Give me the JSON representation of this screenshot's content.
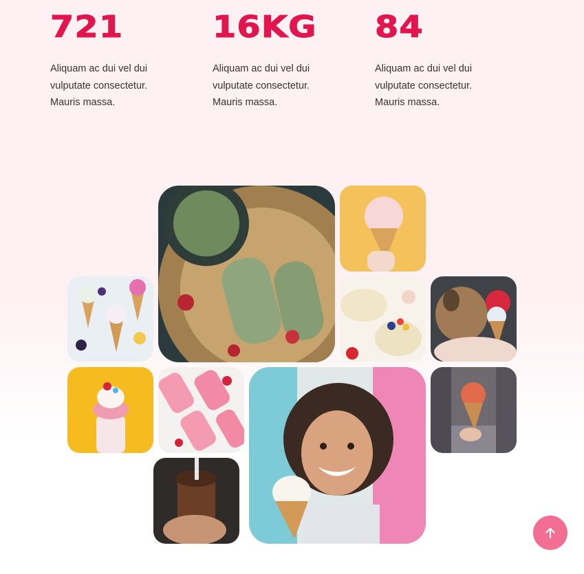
{
  "stats": [
    {
      "value": "721",
      "description": "Aliquam ac dui vel dui vulputate consectetur. Mauris massa."
    },
    {
      "value": "16KG",
      "description": "Aliquam ac dui vel dui vulputate consectetur. Mauris massa."
    },
    {
      "value": "84",
      "description": "Aliquam ac dui vel dui vulputate consectetur. Mauris massa."
    }
  ],
  "gallery": [
    {
      "subject": "matcha-popsicles-plate"
    },
    {
      "subject": "pink-ice-cream-cone"
    },
    {
      "subject": "ice-cream-cones-flatlay"
    },
    {
      "subject": "fruit-ice-cream-cups"
    },
    {
      "subject": "dog-licking-ice-cream"
    },
    {
      "subject": "milkshake-jar"
    },
    {
      "subject": "strawberry-popsicles"
    },
    {
      "subject": "smiling-woman-ice-cream"
    },
    {
      "subject": "ice-cream-street"
    },
    {
      "subject": "chocolate-drink"
    }
  ],
  "icons": {
    "back_to_top": "arrow-up-icon"
  },
  "colors": {
    "accent": "#e2154f",
    "button": "#f26f93",
    "background": "#fef1f3"
  }
}
